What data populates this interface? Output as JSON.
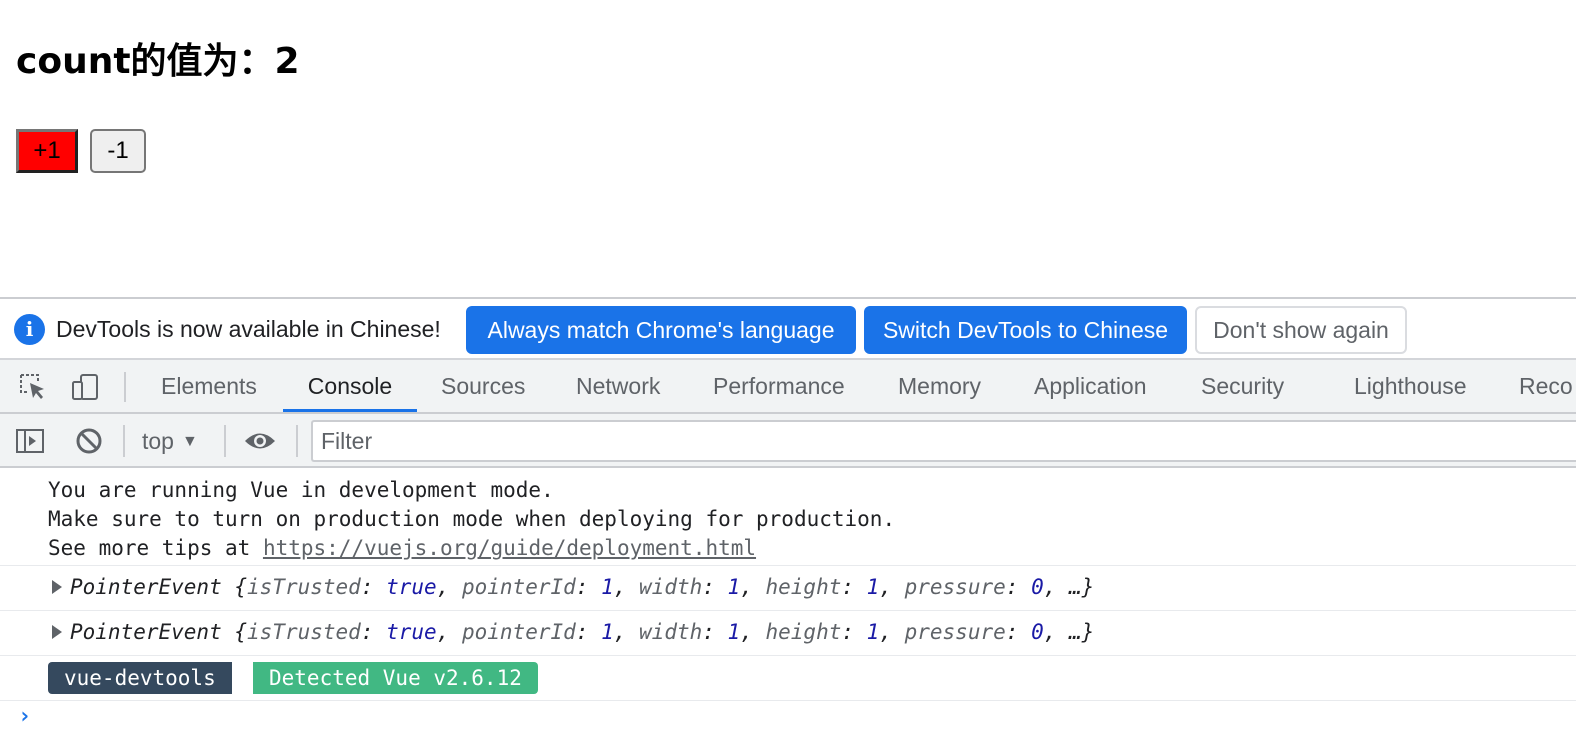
{
  "page": {
    "heading": "count的值为：2",
    "buttons": {
      "increment": "+1",
      "decrement": "-1"
    },
    "colors": {
      "increment_bg": "#ff0000"
    }
  },
  "devtools": {
    "infobar": {
      "message": "DevTools is now available in Chinese!",
      "always_match": "Always match Chrome's language",
      "switch": "Switch DevTools to Chinese",
      "dont_show": "Don't show again"
    },
    "tabs": [
      {
        "label": "Elements"
      },
      {
        "label": "Console",
        "active": true
      },
      {
        "label": "Sources"
      },
      {
        "label": "Network"
      },
      {
        "label": "Performance"
      },
      {
        "label": "Memory"
      },
      {
        "label": "Application"
      },
      {
        "label": "Security"
      },
      {
        "label": "Lighthouse"
      },
      {
        "label": "Reco"
      }
    ],
    "toolbar": {
      "context": "top",
      "filter_placeholder": "Filter"
    },
    "console": {
      "vue_notice": [
        "You are running Vue in development mode.",
        "Make sure to turn on production mode when deploying for production.",
        "See more tips at "
      ],
      "vue_link": "https://vuejs.org/guide/deployment.html",
      "pointer_event": {
        "type": "PointerEvent",
        "isTrusted": "true",
        "pointerId": "1",
        "width": "1",
        "height": "1",
        "pressure": "0",
        "ellipsis": "…}"
      },
      "badge_left": "vue-devtools",
      "badge_right": "Detected Vue v2.6.12",
      "prompt": "›"
    },
    "colors": {
      "accent": "#1a73e8",
      "badge_dark": "#35495e",
      "badge_green": "#41b883"
    }
  }
}
